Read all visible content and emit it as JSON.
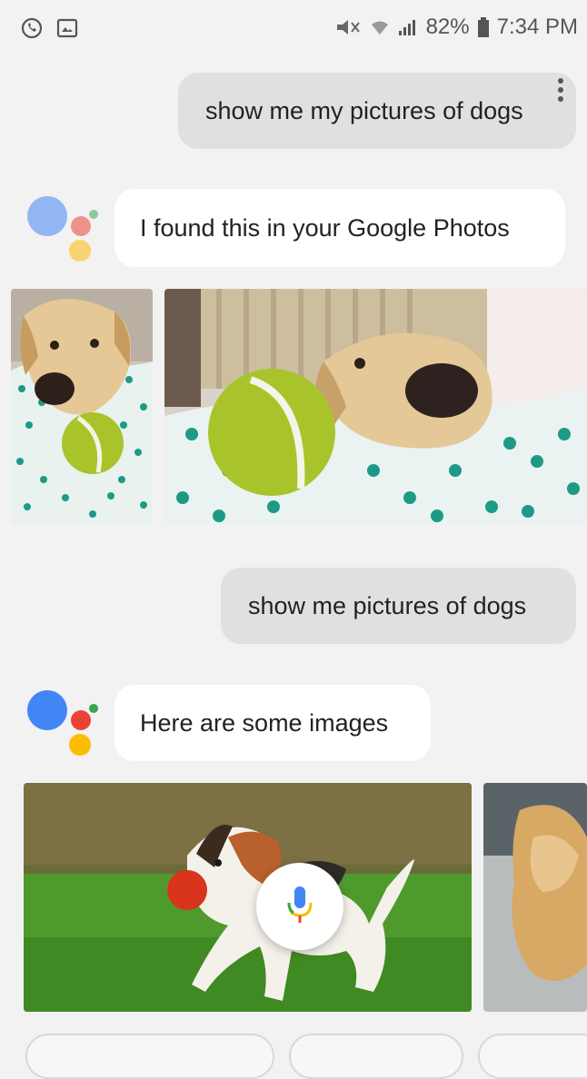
{
  "status_bar": {
    "battery": "82%",
    "time": "7:34 PM",
    "left_icons": [
      "whatsapp-icon",
      "gallery-icon"
    ],
    "right_icons": [
      "mute-icon",
      "wifi-icon",
      "signal-icon",
      "battery-icon"
    ]
  },
  "conversation": {
    "user_query_1": "show me my pictures of dogs",
    "assistant_reply_1": "I found this in your Google Photos",
    "user_query_2": "show me pictures of dogs",
    "assistant_reply_2": "Here are some images"
  },
  "colors": {
    "blue": "#4285f4",
    "red": "#ea4335",
    "yellow": "#fbbc05",
    "green": "#34a853",
    "user_bubble": "#e0e0e0",
    "assistant_bubble": "#ffffff"
  }
}
